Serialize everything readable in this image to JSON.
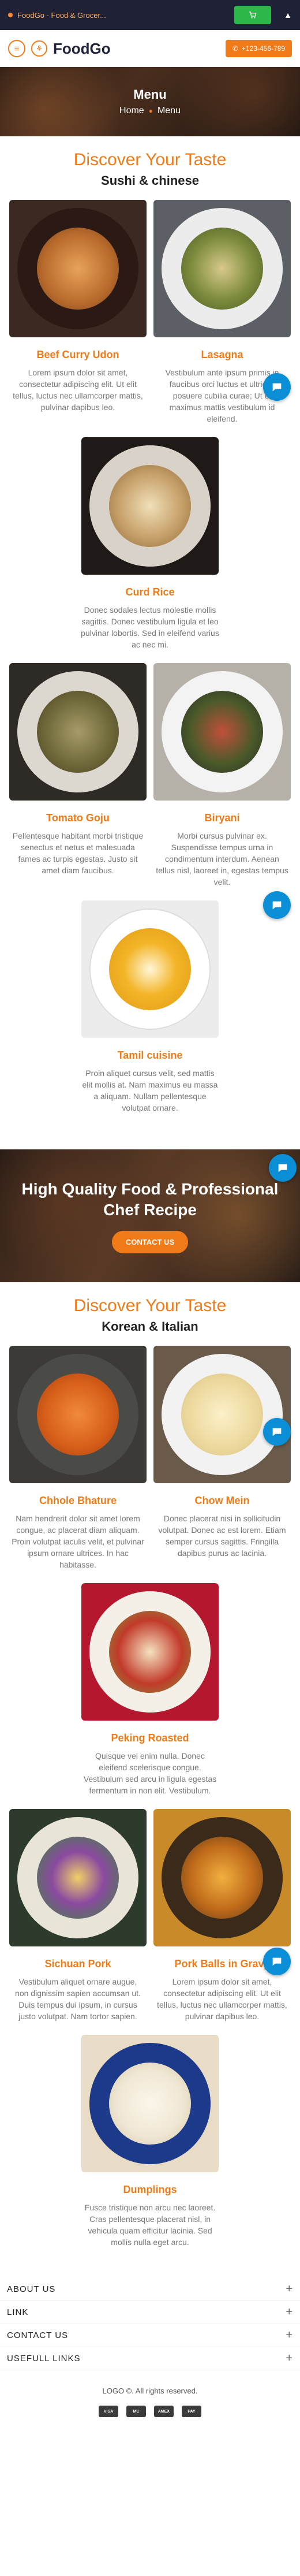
{
  "topbar": {
    "tab_title": "FoodGo - Food & Grocer..."
  },
  "header": {
    "logo": "FoodGo",
    "phone": "+123-456-789"
  },
  "banner": {
    "title": "Menu",
    "crumb_home": "Home",
    "crumb_current": "Menu"
  },
  "section1": {
    "subtitle": "Discover Your Taste",
    "title": "Sushi & chinese",
    "items": [
      {
        "name": "Beef Curry Udon",
        "desc": "Lorem ipsum dolor sit amet, consectetur adipiscing elit. Ut elit tellus, luctus nec ullamcorper mattis, pulvinar dapibus leo."
      },
      {
        "name": "Lasagna",
        "desc": "Vestibulum ante ipsum primis in faucibus orci luctus et ultrices posuere cubilia curae; Ut et maximus mattis vestibulum id eleifend."
      },
      {
        "name": "Curd Rice",
        "desc": "Donec sodales lectus molestie mollis sagittis. Donec vestibulum ligula et leo pulvinar lobortis. Sed in eleifend varius ac nec mi."
      },
      {
        "name": "Tomato Goju",
        "desc": "Pellentesque habitant morbi tristique senectus et netus et malesuada fames ac turpis egestas. Justo sit amet diam faucibus."
      },
      {
        "name": "Biryani",
        "desc": "Morbi cursus pulvinar ex. Suspendisse tempus urna in condimentum interdum. Aenean tellus nisl, laoreet in, egestas tempus velit."
      },
      {
        "name": "Tamil cuisine",
        "desc": "Proin aliquet cursus velit, sed mattis elit mollis at. Nam maximus eu massa a aliquam. Nullam pellentesque volutpat ornare."
      }
    ]
  },
  "promo": {
    "title": "High Quality Food & Professional Chef Recipe",
    "button": "CONTACT US"
  },
  "section2": {
    "subtitle": "Discover Your Taste",
    "title": "Korean & Italian",
    "items": [
      {
        "name": "Chhole Bhature",
        "desc": "Nam hendrerit dolor sit amet lorem congue, ac placerat diam aliquam. Proin volutpat iaculis velit, et pulvinar ipsum ornare ultrices. In hac habitasse."
      },
      {
        "name": "Chow Mein",
        "desc": "Donec placerat nisi in sollicitudin volutpat. Donec ac est lorem. Etiam semper cursus sagittis. Fringilla dapibus purus ac lacinia."
      },
      {
        "name": "Peking Roasted",
        "desc": "Quisque vel enim nulla. Donec eleifend scelerisque congue. Vestibulum sed arcu in ligula egestas fermentum in non elit. Vestibulum."
      },
      {
        "name": "Sichuan Pork",
        "desc": "Vestibulum aliquet ornare augue, non dignissim sapien accumsan ut. Duis tempus dui ipsum, in cursus justo volutpat. Nam tortor sapien."
      },
      {
        "name": "Pork Balls in Gravy",
        "desc": "Lorem ipsum dolor sit amet, consectetur adipiscing elit. Ut elit tellus, luctus nec ullamcorper mattis, pulvinar dapibus leo."
      },
      {
        "name": "Dumplings",
        "desc": "Fusce tristique non arcu nec laoreet. Cras pellentesque placerat nisl, in vehicula quam efficitur lacinia. Sed mollis nulla eget arcu."
      }
    ]
  },
  "footer": {
    "links": [
      "ABOUT US",
      "LINK",
      "CONTACT US",
      "USEFULL LINKS"
    ],
    "copyright": "LOGO ©. All rights reserved.",
    "payments": [
      "VISA",
      "MC",
      "AMEX",
      "PAY"
    ]
  },
  "colors": {
    "accent": "#f07b18",
    "dark": "#1f2137",
    "chat": "#0a8fd6"
  }
}
